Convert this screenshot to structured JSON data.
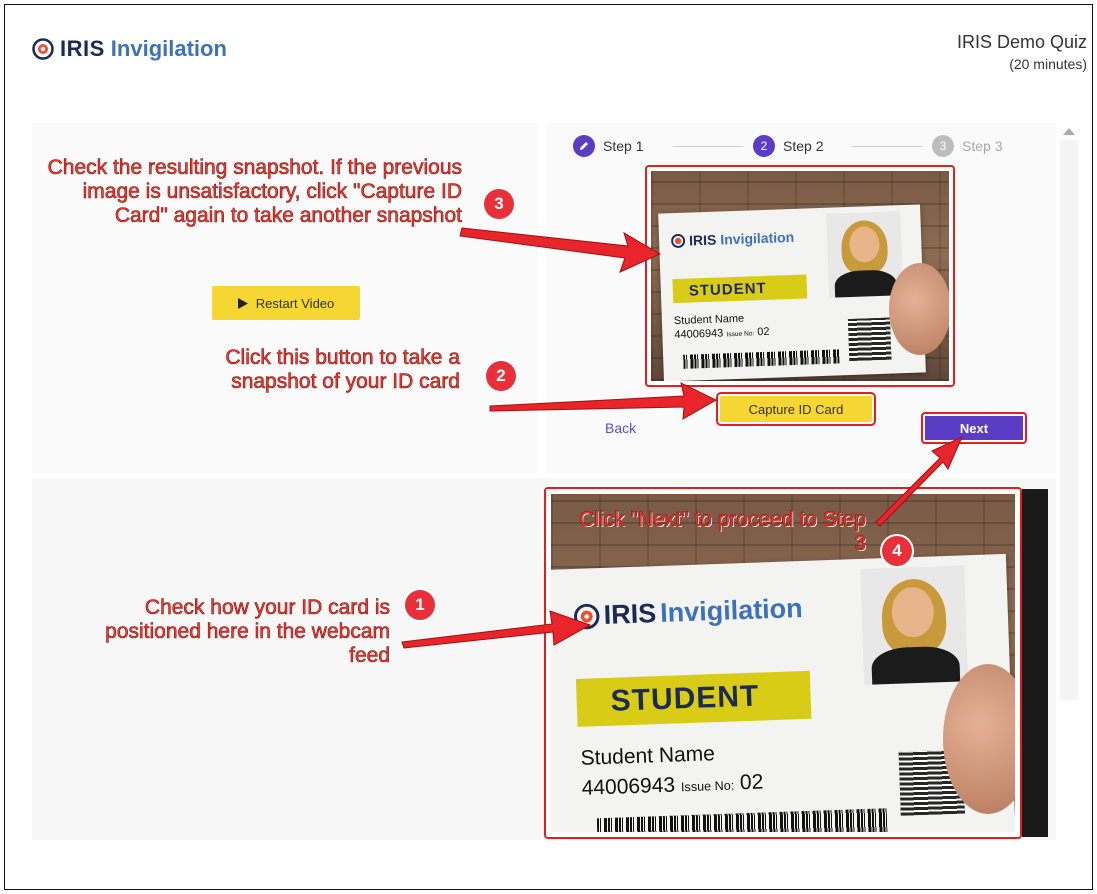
{
  "header": {
    "logo_iris": "IRIS",
    "logo_invigilation": "Invigilation",
    "quiz_title": "IRIS Demo Quiz",
    "quiz_duration": "(20 minutes)"
  },
  "stepper": {
    "steps": [
      {
        "label": "Step 1",
        "number": "",
        "state": "done",
        "icon": "pencil-icon"
      },
      {
        "label": "Step 2",
        "number": "2",
        "state": "active"
      },
      {
        "label": "Step 3",
        "number": "3",
        "state": "inactive"
      }
    ]
  },
  "buttons": {
    "restart_video": "Restart Video",
    "capture_id_card": "Capture ID Card",
    "back": "Back",
    "next": "Next"
  },
  "id_card": {
    "logo_iris": "IRIS",
    "logo_invigilation": "Invigilation",
    "role": "STUDENT",
    "name": "Student Name",
    "number": "44006943",
    "issue_label": "Issue No:",
    "issue_number": "02"
  },
  "annotations": {
    "note_1": "Check how your ID card is positioned here in the webcam feed",
    "note_2": "Click this button to take a snapshot of your ID card",
    "note_3": "Check the resulting snapshot. If the previous image is unsatisfactory, click \"Capture ID Card\" again to take another snapshot",
    "note_4": "Click \"Next\" to proceed to Step 3",
    "badge_1": "1",
    "badge_2": "2",
    "badge_3": "3",
    "badge_4": "4"
  },
  "colors": {
    "accent_purple": "#5b3cc4",
    "button_yellow": "#f6d633",
    "annotation_red": "#f23b2f"
  }
}
